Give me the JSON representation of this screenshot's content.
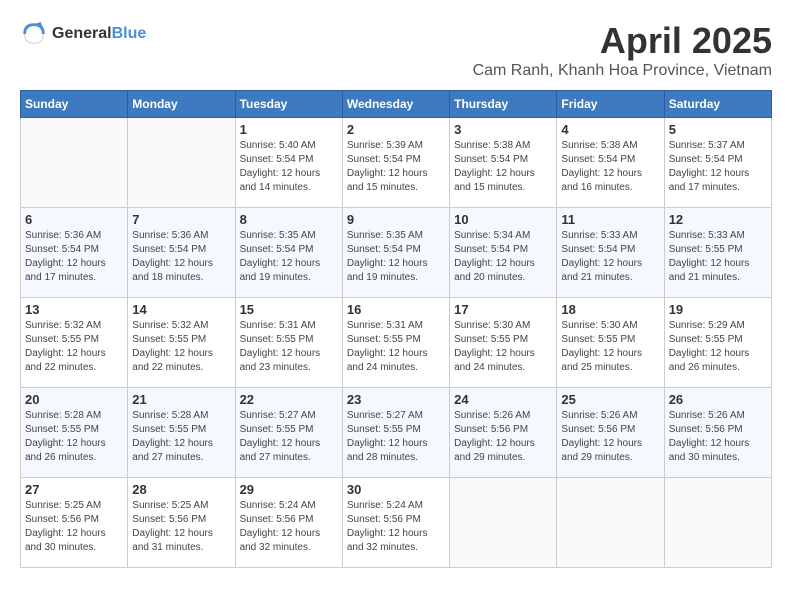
{
  "header": {
    "logo_general": "General",
    "logo_blue": "Blue",
    "month_year": "April 2025",
    "location": "Cam Ranh, Khanh Hoa Province, Vietnam"
  },
  "weekdays": [
    "Sunday",
    "Monday",
    "Tuesday",
    "Wednesday",
    "Thursday",
    "Friday",
    "Saturday"
  ],
  "weeks": [
    [
      {
        "day": null
      },
      {
        "day": null
      },
      {
        "day": "1",
        "sunrise": "5:40 AM",
        "sunset": "5:54 PM",
        "daylight": "12 hours and 14 minutes."
      },
      {
        "day": "2",
        "sunrise": "5:39 AM",
        "sunset": "5:54 PM",
        "daylight": "12 hours and 15 minutes."
      },
      {
        "day": "3",
        "sunrise": "5:38 AM",
        "sunset": "5:54 PM",
        "daylight": "12 hours and 15 minutes."
      },
      {
        "day": "4",
        "sunrise": "5:38 AM",
        "sunset": "5:54 PM",
        "daylight": "12 hours and 16 minutes."
      },
      {
        "day": "5",
        "sunrise": "5:37 AM",
        "sunset": "5:54 PM",
        "daylight": "12 hours and 17 minutes."
      }
    ],
    [
      {
        "day": "6",
        "sunrise": "5:36 AM",
        "sunset": "5:54 PM",
        "daylight": "12 hours and 17 minutes."
      },
      {
        "day": "7",
        "sunrise": "5:36 AM",
        "sunset": "5:54 PM",
        "daylight": "12 hours and 18 minutes."
      },
      {
        "day": "8",
        "sunrise": "5:35 AM",
        "sunset": "5:54 PM",
        "daylight": "12 hours and 19 minutes."
      },
      {
        "day": "9",
        "sunrise": "5:35 AM",
        "sunset": "5:54 PM",
        "daylight": "12 hours and 19 minutes."
      },
      {
        "day": "10",
        "sunrise": "5:34 AM",
        "sunset": "5:54 PM",
        "daylight": "12 hours and 20 minutes."
      },
      {
        "day": "11",
        "sunrise": "5:33 AM",
        "sunset": "5:54 PM",
        "daylight": "12 hours and 21 minutes."
      },
      {
        "day": "12",
        "sunrise": "5:33 AM",
        "sunset": "5:55 PM",
        "daylight": "12 hours and 21 minutes."
      }
    ],
    [
      {
        "day": "13",
        "sunrise": "5:32 AM",
        "sunset": "5:55 PM",
        "daylight": "12 hours and 22 minutes."
      },
      {
        "day": "14",
        "sunrise": "5:32 AM",
        "sunset": "5:55 PM",
        "daylight": "12 hours and 22 minutes."
      },
      {
        "day": "15",
        "sunrise": "5:31 AM",
        "sunset": "5:55 PM",
        "daylight": "12 hours and 23 minutes."
      },
      {
        "day": "16",
        "sunrise": "5:31 AM",
        "sunset": "5:55 PM",
        "daylight": "12 hours and 24 minutes."
      },
      {
        "day": "17",
        "sunrise": "5:30 AM",
        "sunset": "5:55 PM",
        "daylight": "12 hours and 24 minutes."
      },
      {
        "day": "18",
        "sunrise": "5:30 AM",
        "sunset": "5:55 PM",
        "daylight": "12 hours and 25 minutes."
      },
      {
        "day": "19",
        "sunrise": "5:29 AM",
        "sunset": "5:55 PM",
        "daylight": "12 hours and 26 minutes."
      }
    ],
    [
      {
        "day": "20",
        "sunrise": "5:28 AM",
        "sunset": "5:55 PM",
        "daylight": "12 hours and 26 minutes."
      },
      {
        "day": "21",
        "sunrise": "5:28 AM",
        "sunset": "5:55 PM",
        "daylight": "12 hours and 27 minutes."
      },
      {
        "day": "22",
        "sunrise": "5:27 AM",
        "sunset": "5:55 PM",
        "daylight": "12 hours and 27 minutes."
      },
      {
        "day": "23",
        "sunrise": "5:27 AM",
        "sunset": "5:55 PM",
        "daylight": "12 hours and 28 minutes."
      },
      {
        "day": "24",
        "sunrise": "5:26 AM",
        "sunset": "5:56 PM",
        "daylight": "12 hours and 29 minutes."
      },
      {
        "day": "25",
        "sunrise": "5:26 AM",
        "sunset": "5:56 PM",
        "daylight": "12 hours and 29 minutes."
      },
      {
        "day": "26",
        "sunrise": "5:26 AM",
        "sunset": "5:56 PM",
        "daylight": "12 hours and 30 minutes."
      }
    ],
    [
      {
        "day": "27",
        "sunrise": "5:25 AM",
        "sunset": "5:56 PM",
        "daylight": "12 hours and 30 minutes."
      },
      {
        "day": "28",
        "sunrise": "5:25 AM",
        "sunset": "5:56 PM",
        "daylight": "12 hours and 31 minutes."
      },
      {
        "day": "29",
        "sunrise": "5:24 AM",
        "sunset": "5:56 PM",
        "daylight": "12 hours and 32 minutes."
      },
      {
        "day": "30",
        "sunrise": "5:24 AM",
        "sunset": "5:56 PM",
        "daylight": "12 hours and 32 minutes."
      },
      {
        "day": null
      },
      {
        "day": null
      },
      {
        "day": null
      }
    ]
  ],
  "labels": {
    "sunrise": "Sunrise:",
    "sunset": "Sunset:",
    "daylight": "Daylight: 12 hours"
  }
}
